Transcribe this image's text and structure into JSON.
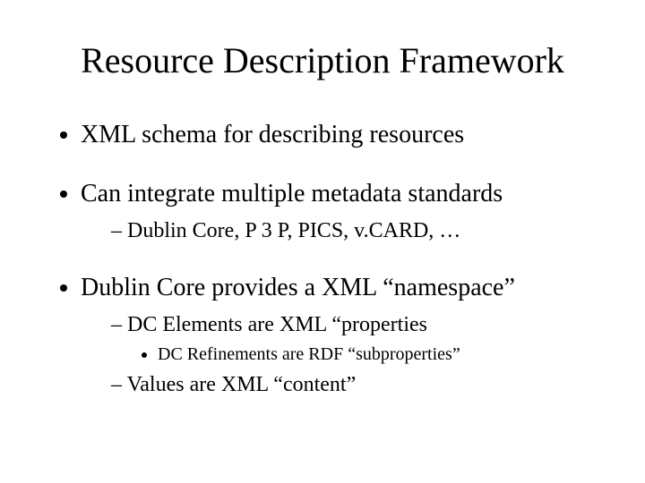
{
  "title": "Resource Description Framework",
  "bullets": {
    "b1": "XML schema for describing resources",
    "b2": "Can integrate multiple metadata standards",
    "b2_sub1": "Dublin Core, P 3 P, PICS, v.CARD, …",
    "b3": "Dublin Core provides a XML “namespace”",
    "b3_sub1": "DC Elements are XML “properties",
    "b3_sub1_sub1": "DC Refinements are RDF “subproperties”",
    "b3_sub2": "Values are XML “content”"
  }
}
